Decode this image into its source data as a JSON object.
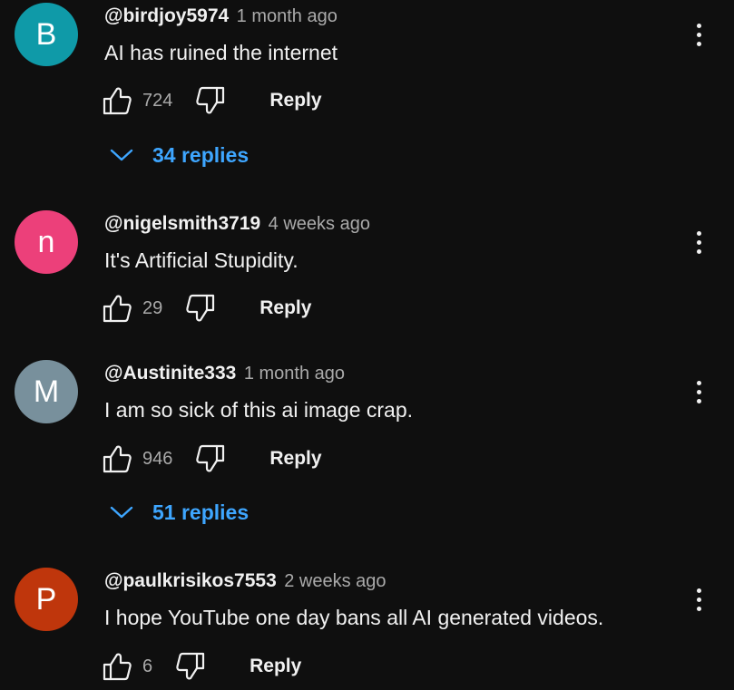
{
  "comments": [
    {
      "avatar_letter": "B",
      "avatar_color": "#0f9aa8",
      "username": "@birdjoy5974",
      "time": "1 month ago",
      "text": "AI has ruined the internet",
      "likes": "724",
      "reply_label": "Reply",
      "replies_label": "34 replies"
    },
    {
      "avatar_letter": "n",
      "avatar_color": "#ec407a",
      "username": "@nigelsmith3719",
      "time": "4 weeks ago",
      "text": "It's Artificial Stupidity.",
      "likes": "29",
      "reply_label": "Reply"
    },
    {
      "avatar_letter": "M",
      "avatar_color": "#78909c",
      "username": "@Austinite333",
      "time": "1 month ago",
      "text": "I am so sick of this ai image crap.",
      "likes": "946",
      "reply_label": "Reply",
      "replies_label": "51 replies"
    },
    {
      "avatar_letter": "P",
      "avatar_color": "#bf360c",
      "username": "@paulkrisikos7553",
      "time": "2 weeks ago",
      "text": "I hope YouTube one day bans all AI generated videos.",
      "likes": "6",
      "reply_label": "Reply"
    }
  ],
  "icons": {
    "like": "thumbs-up-icon",
    "dislike": "thumbs-down-icon",
    "more": "more-vertical-icon",
    "expand": "chevron-down-icon"
  },
  "colors": {
    "background": "#0f0f0f",
    "link": "#3ea6ff",
    "secondary_text": "#aaaaaa"
  }
}
